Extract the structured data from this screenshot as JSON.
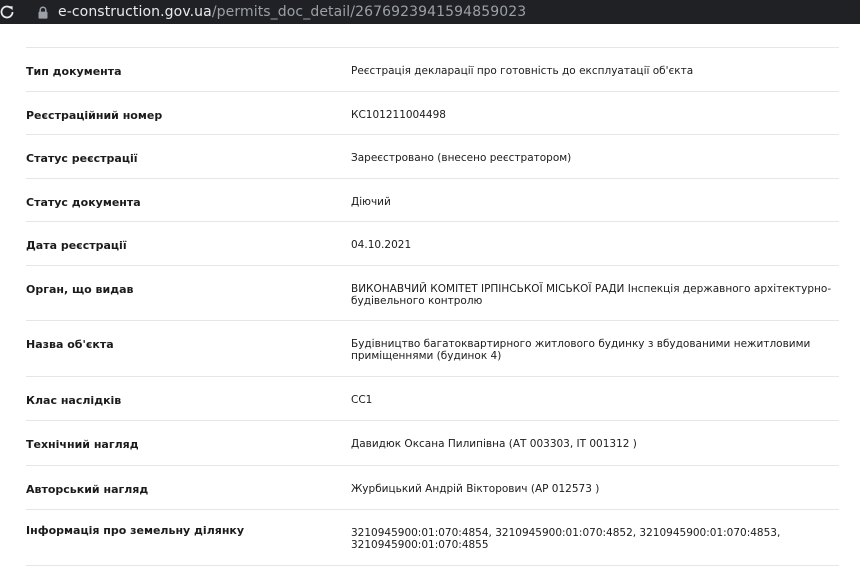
{
  "browser": {
    "url_host": "e-construction.gov.ua",
    "url_path": "/permits_doc_detail/2676923941594859023"
  },
  "rows": [
    {
      "label": "Тип документа",
      "value": "Реєстрація декларації про готовність до експлуатації об'єкта"
    },
    {
      "label": "Реєстраційний номер",
      "value": "КС101211004498"
    },
    {
      "label": "Статус реєстрації",
      "value": "Зареєстровано (внесено реєстратором)"
    },
    {
      "label": "Статус документа",
      "value": "Діючий"
    },
    {
      "label": "Дата реєстрації",
      "value": "04.10.2021"
    },
    {
      "label": "Орган, що видав",
      "value": "ВИКОНАВЧИЙ КОМІТЕТ ІРПІНСЬКОЇ МІСЬКОЇ РАДИ Інспекція державного архітектурно-будівельного контролю"
    },
    {
      "label": "Назва об'єкта",
      "value": "Будівництво багатоквартирного житлового будинку з вбудованими нежитловими приміщеннями (будинок 4)"
    },
    {
      "label": "Клас наслідків",
      "value": "СС1"
    },
    {
      "label": "Технічний нагляд",
      "value": "Давидюк Оксана Пилипівна (АТ 003303, ІТ 001312 )"
    },
    {
      "label": "Авторський нагляд",
      "value": "Журбицький Андрій Вікторович (АР 012573 )"
    },
    {
      "label": "Інформація про земельну ділянку",
      "value": "3210945900:01:070:4854, 3210945900:01:070:4852, 3210945900:01:070:4853, 3210945900:01:070:4855"
    }
  ]
}
